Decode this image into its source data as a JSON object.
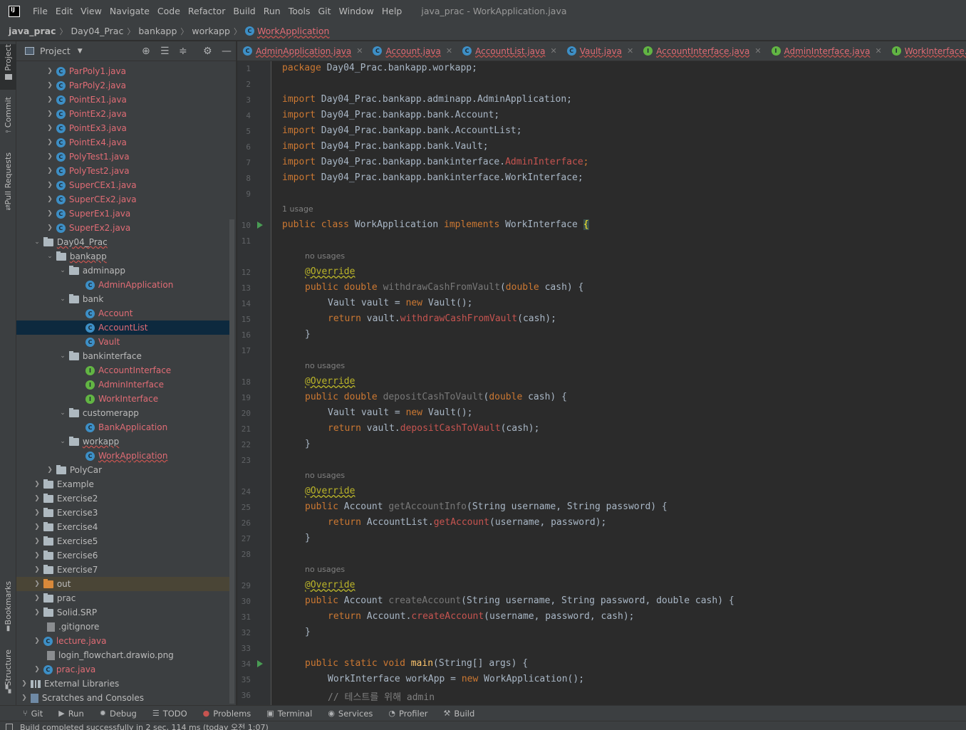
{
  "menu": {
    "items": [
      "File",
      "Edit",
      "View",
      "Navigate",
      "Code",
      "Refactor",
      "Build",
      "Run",
      "Tools",
      "Git",
      "Window",
      "Help"
    ],
    "title": "java_prac - WorkApplication.java"
  },
  "breadcrumb": [
    "java_prac",
    "Day04_Prac",
    "bankapp",
    "workapp",
    "WorkApplication"
  ],
  "left_strip": {
    "project": "Project",
    "commit": "Commit",
    "pull_requests": "Pull Requests",
    "bookmarks": "Bookmarks",
    "structure": "Structure"
  },
  "project_panel": {
    "title": "Project",
    "tree": [
      {
        "label": "ParPoly1.java",
        "icon": "class-icon"
      },
      {
        "label": "ParPoly2.java",
        "icon": "class-icon"
      },
      {
        "label": "PointEx1.java",
        "icon": "class-icon"
      },
      {
        "label": "PointEx2.java",
        "icon": "class-icon"
      },
      {
        "label": "PointEx3.java",
        "icon": "class-icon"
      },
      {
        "label": "PointEx4.java",
        "icon": "class-icon"
      },
      {
        "label": "PolyTest1.java",
        "icon": "class-icon"
      },
      {
        "label": "PolyTest2.java",
        "icon": "class-icon"
      },
      {
        "label": "SuperCEx1.java",
        "icon": "class-icon"
      },
      {
        "label": "SuperCEx2.java",
        "icon": "class-icon"
      },
      {
        "label": "SuperEx1.java",
        "icon": "class-icon"
      },
      {
        "label": "SuperEx2.java",
        "icon": "class-icon"
      },
      {
        "label": "Day04_Prac",
        "icon": "folder-icon"
      },
      {
        "label": "bankapp",
        "icon": "folder-icon"
      },
      {
        "label": "adminapp",
        "icon": "folder-icon"
      },
      {
        "label": "AdminApplication",
        "icon": "class-icon"
      },
      {
        "label": "bank",
        "icon": "folder-icon"
      },
      {
        "label": "Account",
        "icon": "class-icon"
      },
      {
        "label": "AccountList",
        "icon": "class-icon"
      },
      {
        "label": "Vault",
        "icon": "class-icon"
      },
      {
        "label": "bankinterface",
        "icon": "folder-icon"
      },
      {
        "label": "AccountInterface",
        "icon": "interface-icon"
      },
      {
        "label": "AdminInterface",
        "icon": "interface-icon"
      },
      {
        "label": "WorkInterface",
        "icon": "interface-icon"
      },
      {
        "label": "customerapp",
        "icon": "folder-icon"
      },
      {
        "label": "BankApplication",
        "icon": "class-icon"
      },
      {
        "label": "workapp",
        "icon": "folder-icon"
      },
      {
        "label": "WorkApplication",
        "icon": "class-icon"
      },
      {
        "label": "PolyCar",
        "icon": "folder-icon"
      },
      {
        "label": "Example",
        "icon": "folder-icon"
      },
      {
        "label": "Exercise2",
        "icon": "folder-icon"
      },
      {
        "label": "Exercise3",
        "icon": "folder-icon"
      },
      {
        "label": "Exercise4",
        "icon": "folder-icon"
      },
      {
        "label": "Exercise5",
        "icon": "folder-icon"
      },
      {
        "label": "Exercise6",
        "icon": "folder-icon"
      },
      {
        "label": "Exercise7",
        "icon": "folder-icon"
      },
      {
        "label": "out",
        "icon": "folder-icon"
      },
      {
        "label": "prac",
        "icon": "folder-icon"
      },
      {
        "label": "Solid.SRP",
        "icon": "folder-icon"
      },
      {
        "label": ".gitignore",
        "icon": "file-icon"
      },
      {
        "label": "lecture.java",
        "icon": "class-icon"
      },
      {
        "label": "login_flowchart.drawio.png",
        "icon": "file-icon"
      },
      {
        "label": "prac.java",
        "icon": "class-icon"
      },
      {
        "label": "External Libraries",
        "icon": "library-icon"
      },
      {
        "label": "Scratches and Consoles",
        "icon": "scratch-icon"
      }
    ]
  },
  "tabs": [
    "AdminApplication.java",
    "Account.java",
    "AccountList.java",
    "Vault.java",
    "AccountInterface.java",
    "AdminInterface.java",
    "WorkInterface.java"
  ],
  "editor": {
    "line_numbers": [
      "1",
      "2",
      "3",
      "4",
      "5",
      "6",
      "7",
      "8",
      "9",
      "10",
      "11",
      "12",
      "13",
      "14",
      "15",
      "16",
      "17",
      "18",
      "19",
      "20",
      "21",
      "22",
      "23",
      "24",
      "25",
      "26",
      "27",
      "28",
      "29",
      "30",
      "31",
      "32",
      "33",
      "34",
      "35",
      "36"
    ],
    "hints": {
      "usage_1": "1 usage",
      "no_usages": "no usages"
    },
    "code": {
      "package": "package",
      "package_name": " Day04_Prac.bankapp.workapp;",
      "import": "import",
      "imp1": " Day04_Prac.bankapp.adminapp.AdminApplication;",
      "imp2": " Day04_Prac.bankapp.bank.Account;",
      "imp3": " Day04_Prac.bankapp.bank.AccountList;",
      "imp4": " Day04_Prac.bankapp.bank.Vault;",
      "imp5a": " Day04_Prac.bankapp.bankinterface.",
      "imp5b": "AdminInterface",
      "imp6": " Day04_Prac.bankapp.bankinterface.WorkInterface;",
      "public": "public",
      "class": "class",
      "class_name": " WorkApplication ",
      "implements": "implements",
      "iface_name": " WorkInterface ",
      "override": "@Override",
      "double": "double",
      "m1": "withdrawCashFromVault",
      "m2": "depositCashToVault",
      "m3": "getAccountInfo",
      "m4": "createAccount",
      "vault_decl": "Vault vault = ",
      "new": "new",
      "vault_ctor": " Vault();",
      "return": "return",
      "ret_vault": " vault.",
      "cash_param": "(cash);",
      "double_cash": "(double cash) {",
      "close": "}",
      "account": "Account",
      "params3": "(String username, String password) {",
      "ret3a": " AccountList.",
      "getaccount": "getAccount",
      "ret3b": "(username, password);",
      "params4": "(String username, String password, double cash) {",
      "ret4a": " Account.",
      "createaccount": "createAccount",
      "ret4b": "(username, password, cash);",
      "static": "static",
      "void": "void",
      "main": "main",
      "main_params": "(String[] args) {",
      "work_decl": "WorkInterface workApp = ",
      "work_ctor": " WorkApplication();",
      "comment": "// 테스트를 위해 admin"
    }
  },
  "bottom_toolbar": [
    "Git",
    "Run",
    "Debug",
    "TODO",
    "Problems",
    "Terminal",
    "Services",
    "Profiler",
    "Build"
  ],
  "status": "Build completed successfully in 2 sec, 114 ms (today 오전 1:07)"
}
